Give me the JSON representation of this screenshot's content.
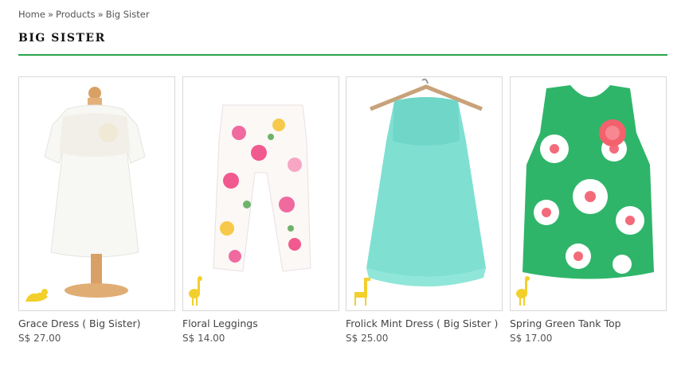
{
  "breadcrumb": {
    "items": [
      "Home",
      "Products",
      "Big Sister"
    ],
    "separator": "»"
  },
  "page": {
    "title": "BIG SISTER"
  },
  "colors": {
    "accent_rule": "#2aa34a",
    "badge": "#f3cf2b"
  },
  "products": [
    {
      "name": "Grace Dress ( Big Sister)",
      "price": "S$ 27.00",
      "badge_icon": "seal-icon"
    },
    {
      "name": "Floral Leggings",
      "price": "S$ 14.00",
      "badge_icon": "ostrich-icon"
    },
    {
      "name": "Frolick Mint Dress ( Big Sister )",
      "price": "S$ 25.00",
      "badge_icon": "giraffe-icon"
    },
    {
      "name": "Spring Green Tank Top",
      "price": "S$ 17.00",
      "badge_icon": "ostrich-icon"
    }
  ]
}
